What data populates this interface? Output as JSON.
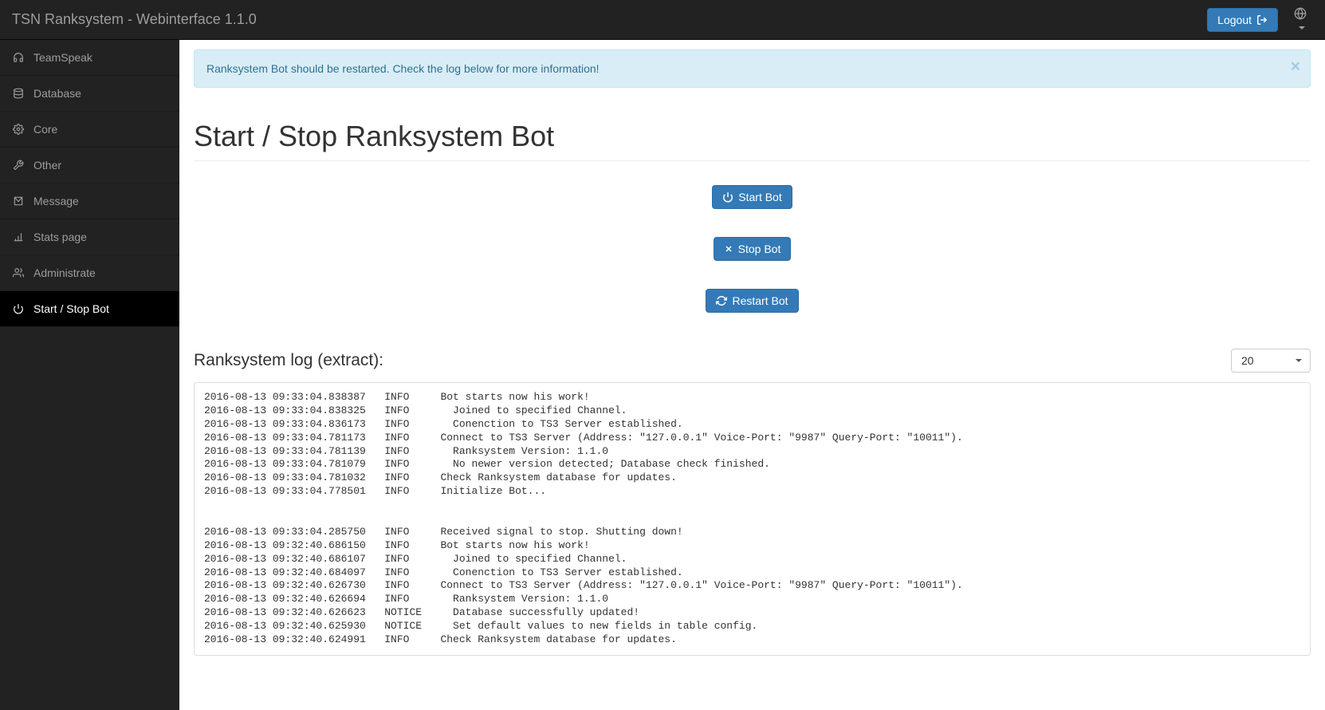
{
  "navbar": {
    "brand": "TSN Ranksystem - Webinterface 1.1.0",
    "logout_label": "Logout"
  },
  "sidebar": {
    "items": [
      {
        "icon": "headphones-icon",
        "label": "TeamSpeak"
      },
      {
        "icon": "database-icon",
        "label": "Database"
      },
      {
        "icon": "cogs-icon",
        "label": "Core"
      },
      {
        "icon": "wrench-icon",
        "label": "Other"
      },
      {
        "icon": "envelope-icon",
        "label": "Message"
      },
      {
        "icon": "barchart-icon",
        "label": "Stats page"
      },
      {
        "icon": "users-icon",
        "label": "Administrate"
      },
      {
        "icon": "power-icon",
        "label": "Start / Stop Bot"
      }
    ]
  },
  "alert": {
    "text": "Ranksystem Bot should be restarted. Check the log below for more information!"
  },
  "page": {
    "title": "Start / Stop Ranksystem Bot",
    "start_label": "Start Bot",
    "stop_label": "Stop Bot",
    "restart_label": "Restart Bot"
  },
  "log": {
    "title": "Ranksystem log (extract):",
    "select_value": "20",
    "entries": [
      "2016-08-13 09:33:04.838387   INFO     Bot starts now his work!",
      "2016-08-13 09:33:04.838325   INFO       Joined to specified Channel.",
      "2016-08-13 09:33:04.836173   INFO       Conenction to TS3 Server established.",
      "2016-08-13 09:33:04.781173   INFO     Connect to TS3 Server (Address: \"127.0.0.1\" Voice-Port: \"9987\" Query-Port: \"10011\").",
      "2016-08-13 09:33:04.781139   INFO       Ranksystem Version: 1.1.0",
      "2016-08-13 09:33:04.781079   INFO       No newer version detected; Database check finished.",
      "2016-08-13 09:33:04.781032   INFO     Check Ranksystem database for updates.",
      "2016-08-13 09:33:04.778501   INFO     Initialize Bot...",
      "",
      "",
      "2016-08-13 09:33:04.285750   INFO     Received signal to stop. Shutting down!",
      "2016-08-13 09:32:40.686150   INFO     Bot starts now his work!",
      "2016-08-13 09:32:40.686107   INFO       Joined to specified Channel.",
      "2016-08-13 09:32:40.684097   INFO       Conenction to TS3 Server established.",
      "2016-08-13 09:32:40.626730   INFO     Connect to TS3 Server (Address: \"127.0.0.1\" Voice-Port: \"9987\" Query-Port: \"10011\").",
      "2016-08-13 09:32:40.626694   INFO       Ranksystem Version: 1.1.0",
      "2016-08-13 09:32:40.626623   NOTICE     Database successfully updated!",
      "2016-08-13 09:32:40.625930   NOTICE     Set default values to new fields in table config.",
      "2016-08-13 09:32:40.624991   INFO     Check Ranksystem database for updates."
    ]
  }
}
